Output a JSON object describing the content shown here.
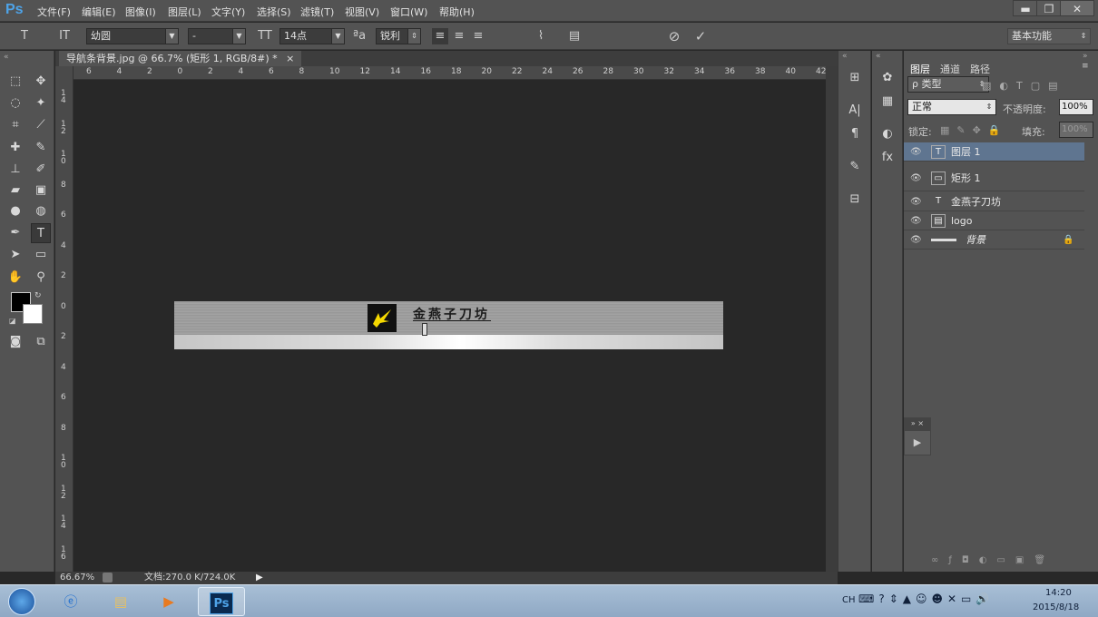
{
  "menubar": {
    "logo": "Ps",
    "items": [
      "文件(F)",
      "编辑(E)",
      "图像(I)",
      "图层(L)",
      "文字(Y)",
      "选择(S)",
      "滤镜(T)",
      "视图(V)",
      "窗口(W)",
      "帮助(H)"
    ],
    "minimize": "▬",
    "restore": "❐",
    "close": "✕"
  },
  "options": {
    "tool_icon": "T",
    "orient_icon": "IT",
    "font_family": "幼圆",
    "font_style": "-",
    "size_icon": "TT",
    "font_size": "14点",
    "aa_icon": "ªa",
    "antialias": "锐利",
    "warp_icon": "⌇",
    "panel_icon": "▤",
    "cancel_icon": "⊘",
    "commit_icon": "✓",
    "workspace": "基本功能"
  },
  "document": {
    "tab_title": "导航条背景.jpg @ 66.7% (矩形 1, RGB/8#) *",
    "tab_close": "×",
    "ruler_h": [
      "6",
      "4",
      "2",
      "0",
      "2",
      "4",
      "6",
      "8",
      "10",
      "12",
      "14",
      "16",
      "18",
      "20",
      "22",
      "24",
      "26",
      "28",
      "30",
      "32",
      "34",
      "36",
      "38",
      "40",
      "42"
    ],
    "ruler_v": [
      "1\n4",
      "1\n2",
      "1\n0",
      "8",
      "6",
      "4",
      "2",
      "0",
      "2",
      "4",
      "6",
      "8",
      "1\n0",
      "1\n2",
      "1\n4",
      "1\n6"
    ],
    "banner_brand": "金燕子刀坊"
  },
  "status": {
    "zoom": "66.67%",
    "doc_info": "文档:270.0 K/724.0K",
    "arrow": "▶"
  },
  "layers_panel": {
    "tabs": [
      "图层",
      "通道",
      "路径"
    ],
    "filter_label": "ρ 类型",
    "blend_mode": "正常",
    "opacity_label": "不透明度:",
    "opacity_value": "100%",
    "lock_label": "锁定:",
    "fill_label": "填充:",
    "fill_value": "100%",
    "layers": [
      {
        "name": "图层 1",
        "thumb": "T",
        "selected": true
      },
      {
        "name": "矩形 1",
        "thumb": "▭",
        "selected": false
      },
      {
        "name": "金燕子刀坊",
        "thumb": "T",
        "selected": false
      },
      {
        "name": "logo",
        "thumb": "▤",
        "selected": false
      },
      {
        "name": "背景",
        "thumb": "",
        "selected": false,
        "locked": true
      }
    ],
    "bottom_icons": [
      "link-icon",
      "fx-icon",
      "mask-icon",
      "adjustment-icon",
      "folder-icon",
      "new-layer-icon",
      "trash-icon"
    ]
  },
  "taskbar": {
    "lang": "CH",
    "time": "14:20",
    "date": "2015/8/18"
  },
  "colors": {
    "menubar": "#535353",
    "canvas_bg": "#282828",
    "selected_layer": "#5f7590",
    "logo_yellow": "#f5d800",
    "ps_blue": "#4ea3e8"
  }
}
